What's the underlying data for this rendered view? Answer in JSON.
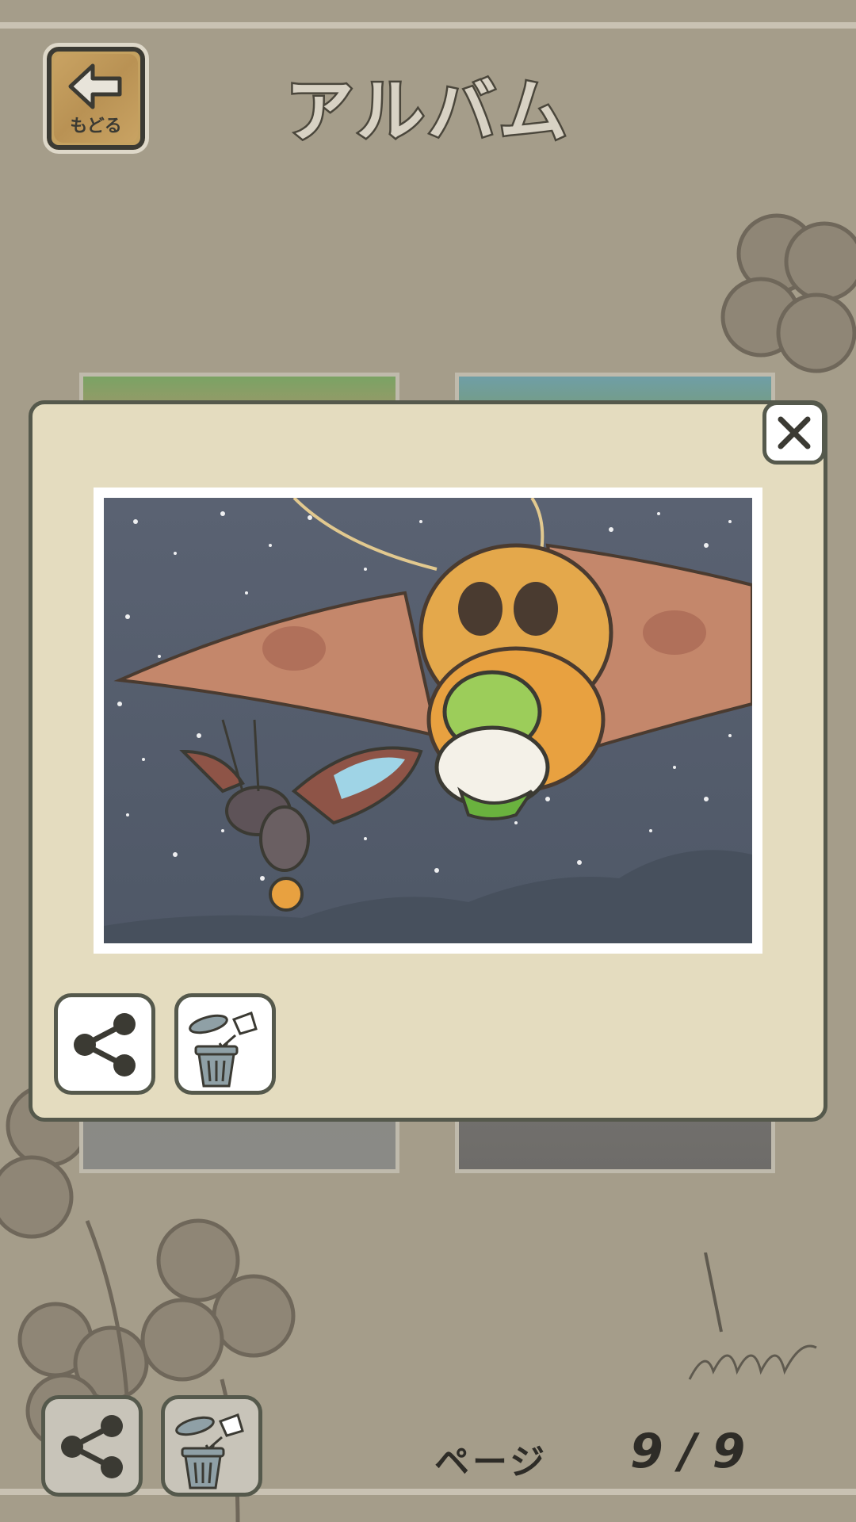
{
  "header": {
    "title": "アルバム",
    "back_label": "もどる"
  },
  "pagination": {
    "label": "ページ",
    "current": "9",
    "separator": "/",
    "total": "9"
  },
  "modal": {
    "close_icon": "close-icon",
    "share_icon": "share-icon",
    "trash_icon": "trash-icon"
  },
  "colors": {
    "background": "#a59d8a",
    "modal_bg": "#e4dcbf",
    "border": "#55594c",
    "back_button_wood": "#c4a160"
  }
}
